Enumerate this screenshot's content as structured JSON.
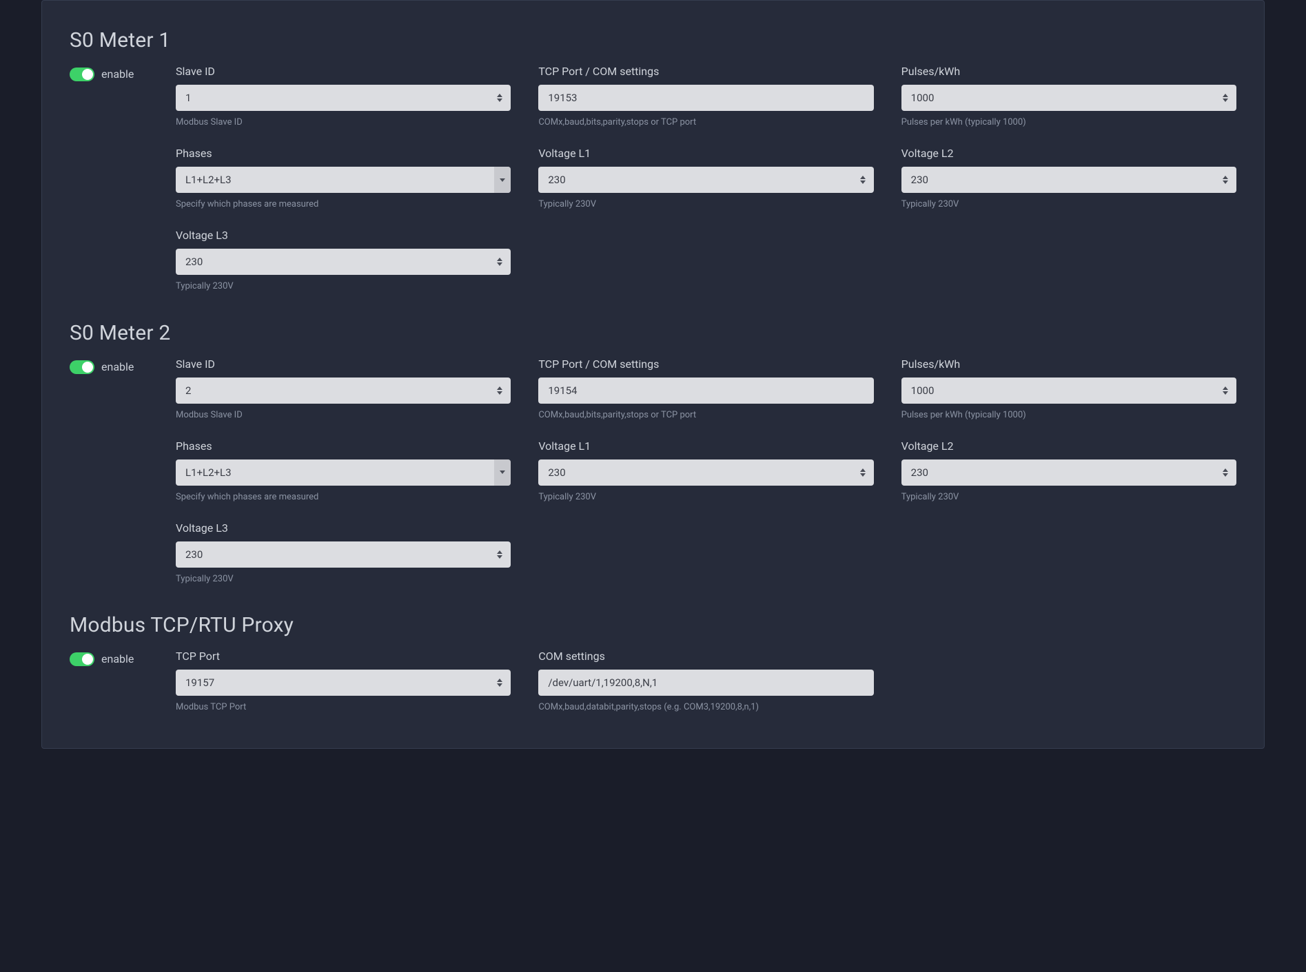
{
  "common": {
    "enable_label": "enable"
  },
  "sections": {
    "meter1": {
      "title": "S0 Meter 1",
      "slave_id": {
        "label": "Slave ID",
        "value": "1",
        "help": "Modbus Slave ID"
      },
      "tcp_com": {
        "label": "TCP Port / COM settings",
        "value": "19153",
        "help": "COMx,baud,bits,parity,stops or TCP port"
      },
      "pulses": {
        "label": "Pulses/kWh",
        "value": "1000",
        "help": "Pulses per kWh (typically 1000)"
      },
      "phases": {
        "label": "Phases",
        "value": "L1+L2+L3",
        "help": "Specify which phases are measured"
      },
      "v_l1": {
        "label": "Voltage L1",
        "value": "230",
        "help": "Typically 230V"
      },
      "v_l2": {
        "label": "Voltage L2",
        "value": "230",
        "help": "Typically 230V"
      },
      "v_l3": {
        "label": "Voltage L3",
        "value": "230",
        "help": "Typically 230V"
      }
    },
    "meter2": {
      "title": "S0 Meter 2",
      "slave_id": {
        "label": "Slave ID",
        "value": "2",
        "help": "Modbus Slave ID"
      },
      "tcp_com": {
        "label": "TCP Port / COM settings",
        "value": "19154",
        "help": "COMx,baud,bits,parity,stops or TCP port"
      },
      "pulses": {
        "label": "Pulses/kWh",
        "value": "1000",
        "help": "Pulses per kWh (typically 1000)"
      },
      "phases": {
        "label": "Phases",
        "value": "L1+L2+L3",
        "help": "Specify which phases are measured"
      },
      "v_l1": {
        "label": "Voltage L1",
        "value": "230",
        "help": "Typically 230V"
      },
      "v_l2": {
        "label": "Voltage L2",
        "value": "230",
        "help": "Typically 230V"
      },
      "v_l3": {
        "label": "Voltage L3",
        "value": "230",
        "help": "Typically 230V"
      }
    },
    "proxy": {
      "title": "Modbus TCP/RTU Proxy",
      "tcp_port": {
        "label": "TCP Port",
        "value": "19157",
        "help": "Modbus TCP Port"
      },
      "com": {
        "label": "COM settings",
        "value": "/dev/uart/1,19200,8,N,1",
        "help": "COMx,baud,databit,parity,stops (e.g. COM3,19200,8,n,1)"
      }
    }
  }
}
